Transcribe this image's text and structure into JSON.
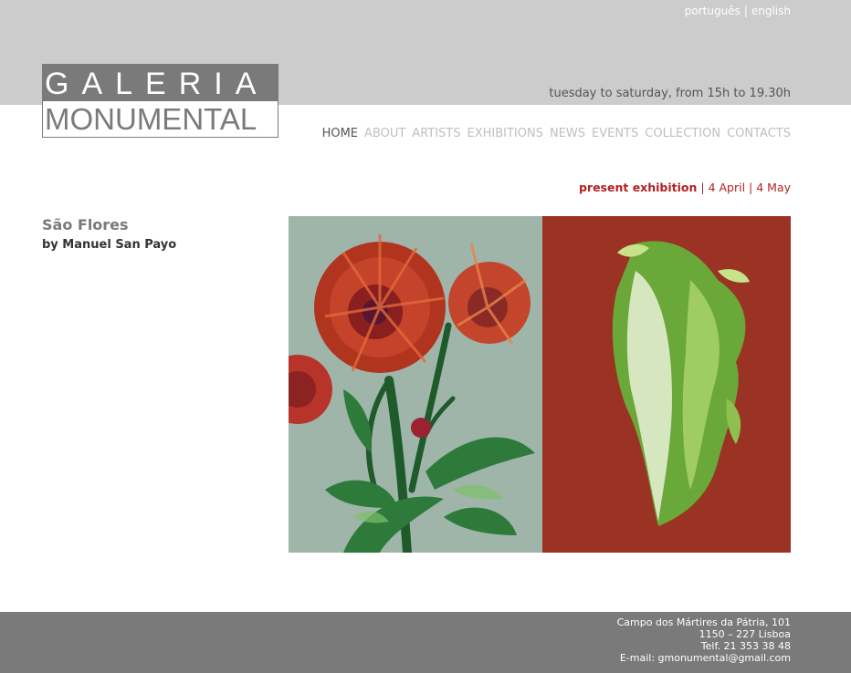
{
  "header": {
    "lang_portugues": "português",
    "lang_separator": "|",
    "lang_english": "english",
    "hours": "tuesday to saturday, from 15h to 19.30h"
  },
  "logo": {
    "line1": "GALERIA",
    "line2": "MONUMENTAL"
  },
  "nav": {
    "items": [
      {
        "label": "HOME",
        "active": true
      },
      {
        "label": "ABOUT",
        "active": false
      },
      {
        "label": "ARTISTS",
        "active": false
      },
      {
        "label": "EXHIBITIONS",
        "active": false
      },
      {
        "label": "NEWS",
        "active": false
      },
      {
        "label": "EVENTS",
        "active": false
      },
      {
        "label": "COLLECTION",
        "active": false
      },
      {
        "label": "CONTACTS",
        "active": false
      }
    ]
  },
  "present": {
    "label": "present exhibition",
    "dates": "| 4 April | 4 May"
  },
  "exhibition": {
    "title": "São Flores",
    "artist": "by Manuel San Payo"
  },
  "footer": {
    "address1": "Campo dos Mártires da Pátria, 101",
    "address2": "1150 – 227 Lisboa",
    "phone": "Telf. 21 353 38 48",
    "email": "E-mail: gmonumental@gmail.com"
  },
  "colors": {
    "top_band": "#cccccc",
    "logo_gray": "#7a7a7a",
    "accent_red": "#b32121",
    "footer": "#7a7a7a",
    "nav_inactive": "#bfbfbf",
    "nav_active": "#555555"
  }
}
